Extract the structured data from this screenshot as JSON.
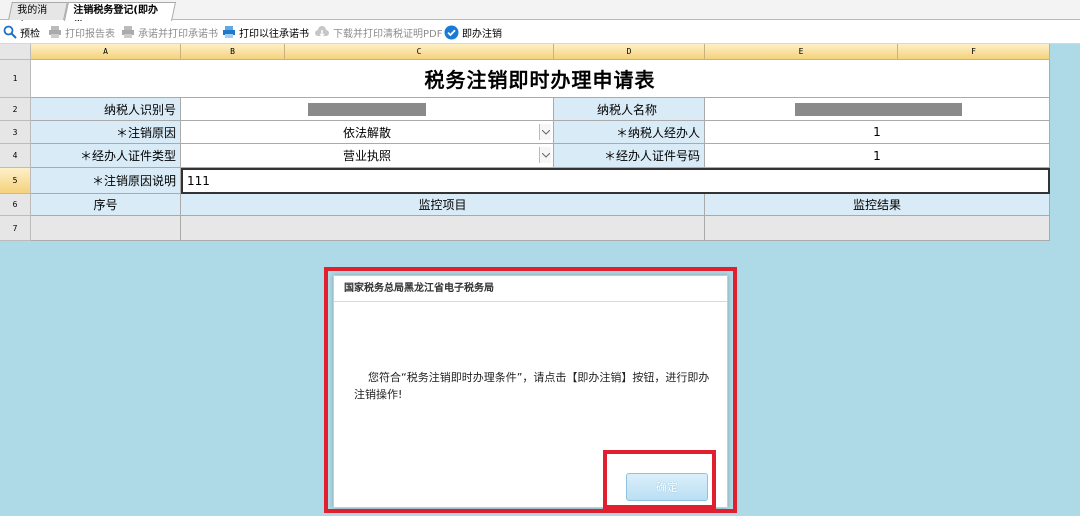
{
  "tabs": [
    {
      "label": "我的消息"
    },
    {
      "label": "注销税务登记(即办类)"
    }
  ],
  "toolbar": {
    "preview": "预检",
    "print_report": "打印报告表",
    "pledge_print": "承诺并打印承诺书",
    "print_past_pledge": "打印以往承诺书",
    "download_pdf": "下载并打印清税证明PDF",
    "cancel_now": "即办注销"
  },
  "columns": [
    "A",
    "B",
    "C",
    "D",
    "E",
    "F"
  ],
  "rows": [
    "1",
    "2",
    "3",
    "4",
    "5",
    "6",
    "7"
  ],
  "form": {
    "title": "税务注销即时办理申请表",
    "taxpayer_id_label": "纳税人识别号",
    "taxpayer_name_label": "纳税人名称",
    "reason_label": "＊注销原因",
    "reason_value": "依法解散",
    "agent_label": "＊纳税人经办人",
    "agent_value": "1",
    "cert_type_label": "＊经办人证件类型",
    "cert_type_value": "营业执照",
    "cert_no_label": "＊经办人证件号码",
    "cert_no_value": "1",
    "reason_desc_label": "＊注销原因说明",
    "reason_desc_value": "111",
    "col_seq": "序号",
    "col_item": "监控项目",
    "col_result": "监控结果"
  },
  "dialog": {
    "title": "国家税务总局黑龙江省电子税务局",
    "message": "您符合“税务注销即时办理条件”，请点击【即办注销】按钮，进行即办注销操作!",
    "ok_label": "确定"
  },
  "colors": {
    "highlight": "#e0202e",
    "label_bg": "#d9ebf7",
    "sheet_bg": "#aed9e6"
  }
}
